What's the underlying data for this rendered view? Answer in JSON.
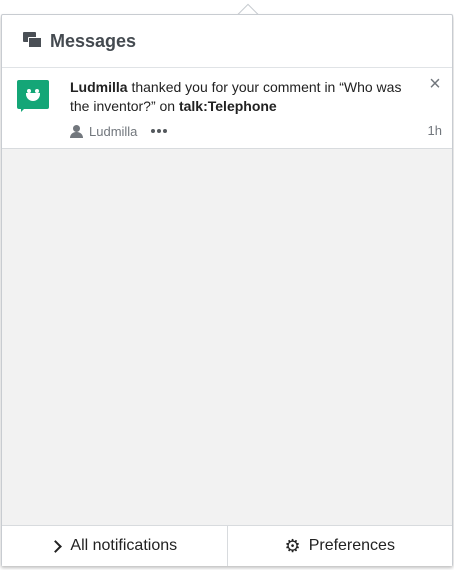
{
  "header": {
    "title": "Messages",
    "icon": "messages-icon"
  },
  "notification": {
    "user": "Ludmilla",
    "text_middle": " thanked you for your comment in “Who was the inventor?” on ",
    "page": "talk:Telephone",
    "meta_user": "Ludmilla",
    "time": "1h",
    "avatar_icon": "thanks-icon",
    "avatar_color": "#14a677"
  },
  "footer": {
    "all_notifications": "All notifications",
    "preferences": "Preferences"
  }
}
